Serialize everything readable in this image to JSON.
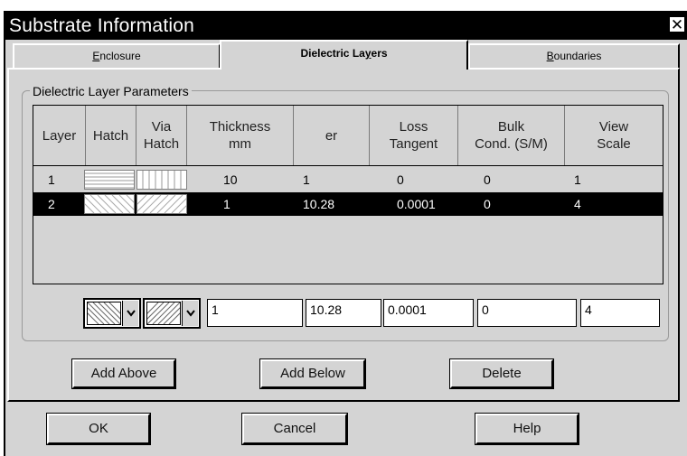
{
  "window": {
    "title": "Substrate Information",
    "close_glyph": "✕"
  },
  "tabs": [
    {
      "label": "Enclosure",
      "accel": "E",
      "active": false
    },
    {
      "label": "Dielectric Layers",
      "accel": "y",
      "active": true
    },
    {
      "label": "Boundaries",
      "accel": "B",
      "active": false
    }
  ],
  "group": {
    "label": "Dielectric Layer Parameters"
  },
  "columns": [
    {
      "line1": "Layer",
      "line2": ""
    },
    {
      "line1": "Hatch",
      "line2": ""
    },
    {
      "line1": "Via",
      "line2": "Hatch"
    },
    {
      "line1": "Thickness",
      "line2": "mm"
    },
    {
      "line1": "er",
      "line2": ""
    },
    {
      "line1": "Loss",
      "line2": "Tangent"
    },
    {
      "line1": "Bulk",
      "line2": "Cond. (S/M)"
    },
    {
      "line1": "View",
      "line2": "Scale"
    }
  ],
  "rows": [
    {
      "layer": "1",
      "hatch_icon": "horizontal-hatch-icon",
      "via_icon": "vertical-hatch-icon",
      "thickness": "10",
      "er": "1",
      "loss_tangent": "0",
      "bulk_cond": "0",
      "view_scale": "1",
      "selected": false
    },
    {
      "layer": "2",
      "hatch_icon": "diagonal-hatch-icon",
      "via_icon": "diagonal-hatch-icon",
      "thickness": "1",
      "er": "10.28",
      "loss_tangent": "0.0001",
      "bulk_cond": "0",
      "view_scale": "4",
      "selected": true
    }
  ],
  "edit": {
    "thickness": "1",
    "er": "10.28",
    "loss_tangent": "0.0001",
    "bulk_cond": "0",
    "view_scale": "4"
  },
  "buttons": {
    "add_above": "Add Above",
    "add_below": "Add Below",
    "delete": "Delete",
    "ok": "OK",
    "cancel": "Cancel",
    "help": "Help"
  },
  "colors": {
    "dialog_bg": "#d4d4d4",
    "title_bg": "#000000",
    "selected_row_bg": "#000000"
  }
}
